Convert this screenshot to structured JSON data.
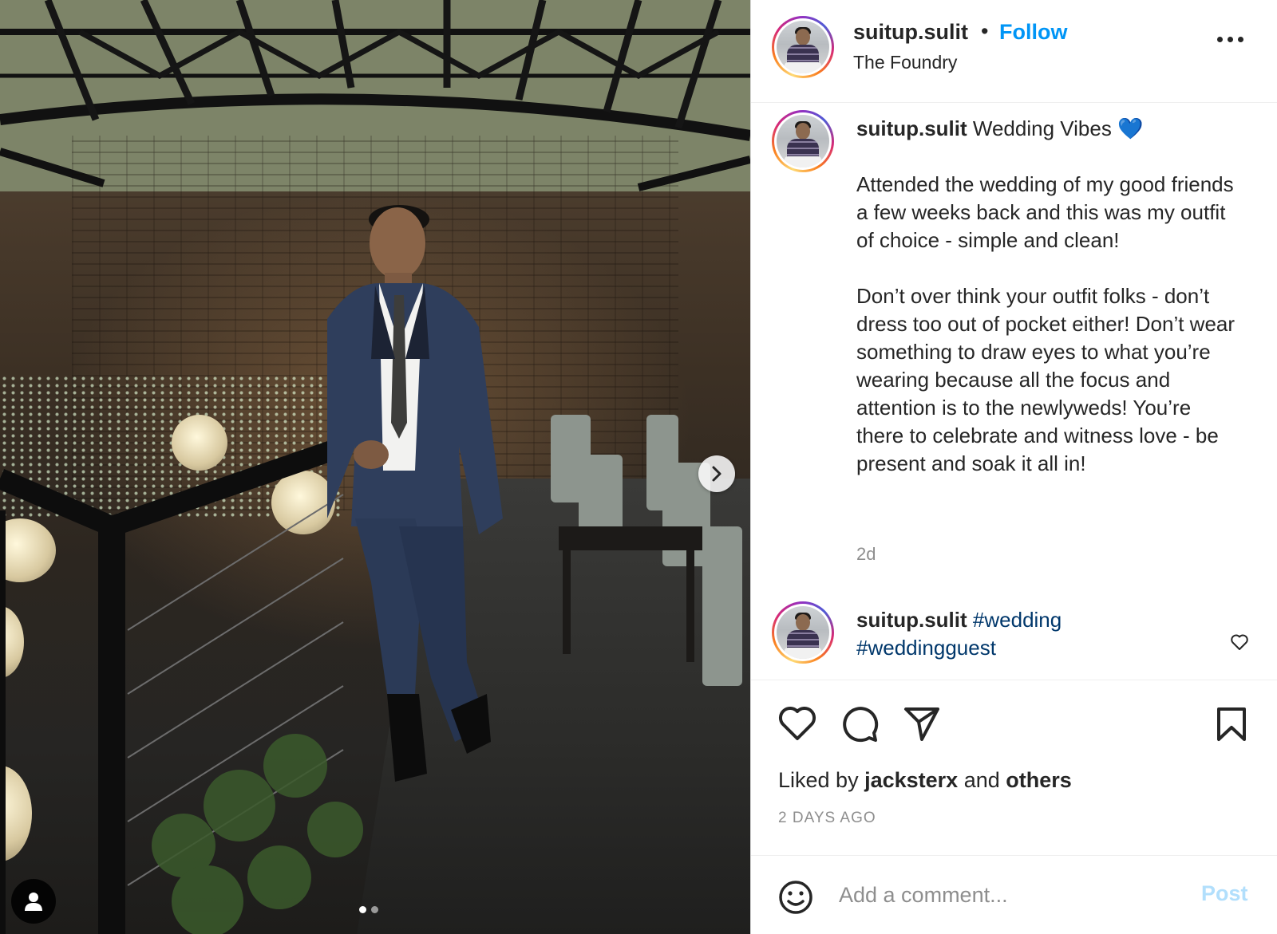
{
  "header": {
    "username": "suitup.sulit",
    "separator": "•",
    "follow_label": "Follow",
    "location": "The Foundry"
  },
  "caption": {
    "username": "suitup.sulit",
    "title": "Wedding Vibes 💙",
    "paragraph1": "Attended the wedding of my good friends a few weeks back and this was my outfit of choice - simple and clean!",
    "paragraph2": "Don’t over think your outfit folks - don’t dress too out of pocket either! Don’t wear something to draw eyes to what you’re wearing because all the focus and attention is to the newlyweds! You’re there to celebrate and witness love - be present and soak it all in!",
    "time": "2d"
  },
  "comment": {
    "username": "suitup.sulit",
    "hashtags": [
      "#wedding",
      "#weddingguest"
    ]
  },
  "engagement": {
    "liked_by_prefix": "Liked by",
    "liked_by_user": "jacksterx",
    "liked_by_and": "and",
    "liked_by_others": "others",
    "posted_ago": "2 DAYS AGO"
  },
  "composer": {
    "placeholder": "Add a comment...",
    "post_label": "Post"
  },
  "carousel": {
    "slide_count": 2,
    "current_slide": 1
  },
  "icons": {
    "next": "chevron-right-icon",
    "tag": "user-tag-icon",
    "more": "more-options-icon",
    "like": "heart-icon",
    "comment": "comment-icon",
    "share": "share-icon",
    "save": "bookmark-icon",
    "emoji": "emoji-icon"
  },
  "colors": {
    "link_blue": "#0095f6",
    "hashtag_blue": "#00376b",
    "post_disabled": "#b2dffc",
    "muted_text": "#8e8e8e"
  }
}
